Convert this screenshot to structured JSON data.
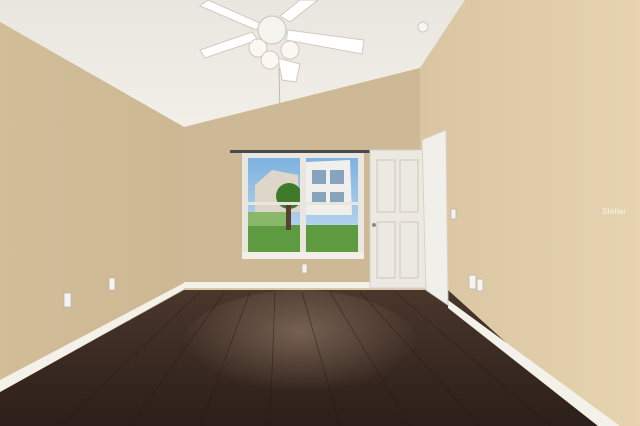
{
  "scene": {
    "kind": "empty bedroom photo",
    "colors": {
      "wall_left": "#d3bf9c",
      "wall_back": "#cdb996",
      "wall_right": "#e0cca8",
      "ceiling": "#eeebe4",
      "floor": "#3a2a22",
      "trim": "#f4f1ea",
      "door": "#ece9e3"
    },
    "icons": [
      "ceiling-fan-icon",
      "window",
      "door",
      "outlet"
    ]
  },
  "watermark": {
    "text": "Stellar"
  }
}
